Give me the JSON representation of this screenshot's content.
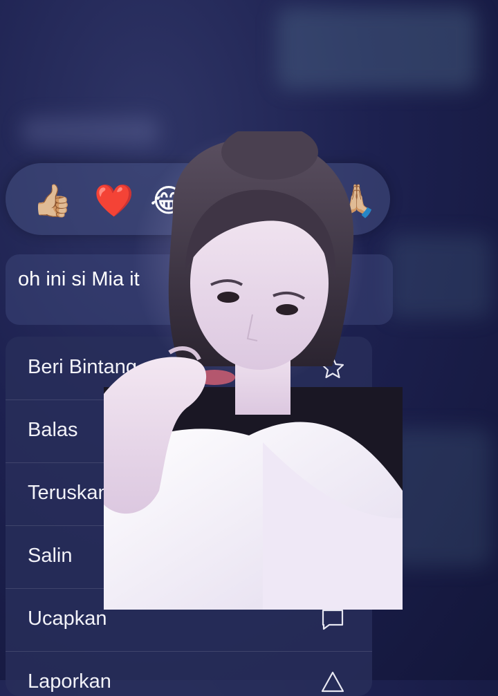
{
  "reactions": [
    {
      "emoji": "👍🏼",
      "name": "thumbs-up"
    },
    {
      "emoji": "❤️",
      "name": "heart"
    },
    {
      "emoji": "😂",
      "name": "laughing"
    },
    {
      "emoji": "🙏🏼",
      "name": "pray"
    }
  ],
  "message": {
    "text": "oh ini si Mia it"
  },
  "menu": {
    "items": [
      {
        "label": "Beri Bintang",
        "icon": "star-icon"
      },
      {
        "label": "Balas",
        "icon": "reply-icon"
      },
      {
        "label": "Teruskan",
        "icon": "forward-icon"
      },
      {
        "label": "Salin",
        "icon": "copy-icon"
      },
      {
        "label": "Ucapkan",
        "icon": "speech-bubble-icon"
      },
      {
        "label": "Laporkan",
        "icon": "warning-icon"
      }
    ]
  },
  "overlay_photo": {
    "subject": "photo-overlay"
  }
}
